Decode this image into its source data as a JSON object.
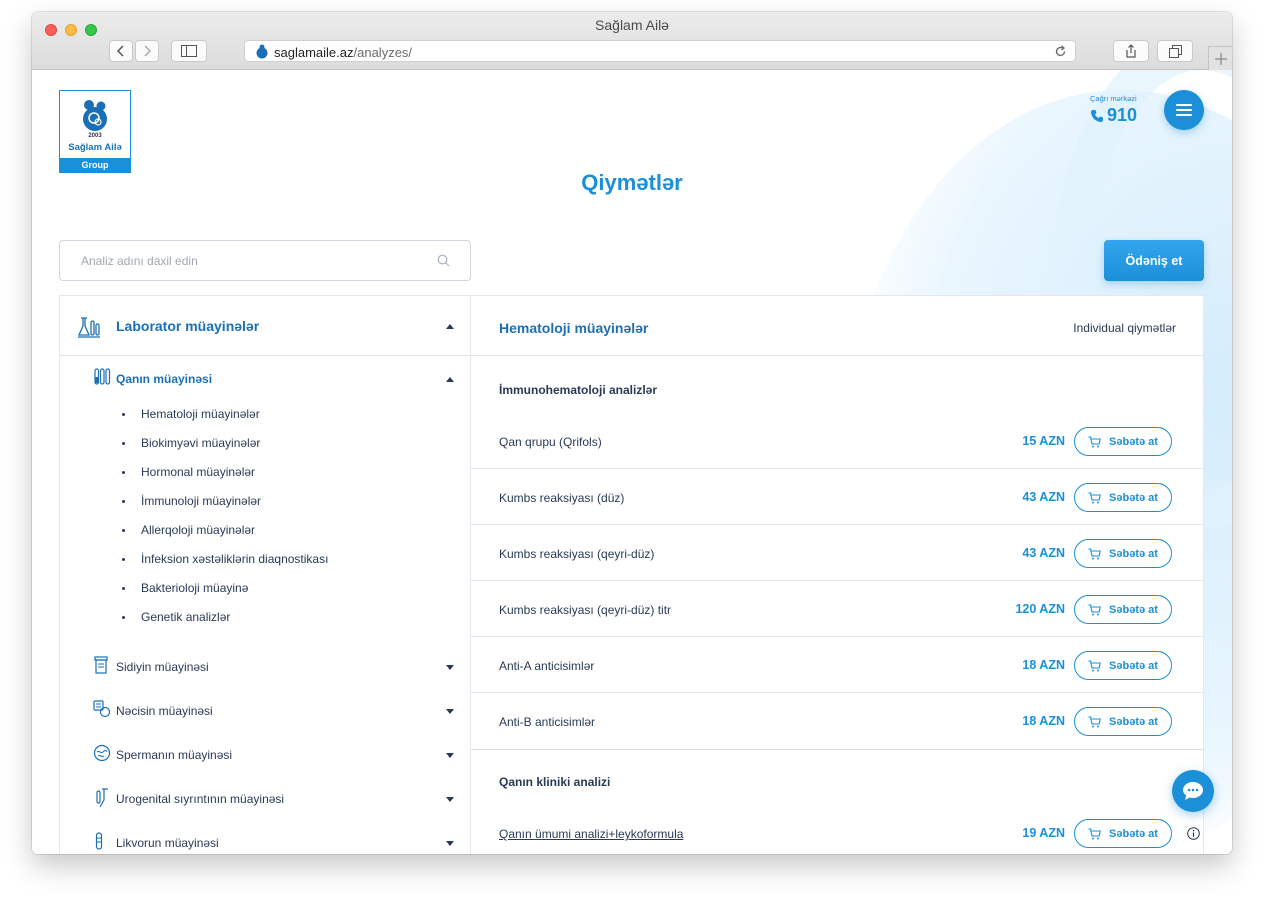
{
  "browser": {
    "window_title": "Sağlam Ailə",
    "url_domain": "saglamaile.az",
    "url_path": "/analyzes/"
  },
  "header": {
    "logo": {
      "year": "2003",
      "name": "Sağlam Ailə",
      "group": "Group"
    },
    "call_center_label": "Çağrı mərkəzi",
    "call_center_number": "910"
  },
  "page_title": "Qiymətlər",
  "search": {
    "placeholder": "Analiz adını daxil edin"
  },
  "pay_button": "Ödəniş et",
  "sidebar": {
    "section_title": "Laborator müayinələr",
    "categories": [
      {
        "label": "Qanın müayinəsi",
        "icon": "test-tubes-icon",
        "subitems": [
          "Hematoloji müayinələr",
          "Biokimyəvi müayinələr",
          "Hormonal müayinələr",
          "İmmunoloji müayinələr",
          "Allerqoloji müayinələr",
          "İnfeksion xəstəliklərin diaqnostikası",
          "Bakterioloji müayinə",
          "Genetik analizlər"
        ]
      },
      {
        "label": "Sidiyin müayinəsi",
        "icon": "urine-container-icon"
      },
      {
        "label": "Nəcisin müayinəsi",
        "icon": "stool-sample-icon"
      },
      {
        "label": "Spermanın müayinəsi",
        "icon": "sperm-icon"
      },
      {
        "label": "Urogenital sıyrıntının müayinəsi",
        "icon": "swab-icon"
      },
      {
        "label": "Likvorun müayinəsi",
        "icon": "vial-icon"
      }
    ]
  },
  "content": {
    "title": "Hematoloji müayinələr",
    "individual_prices": "Individual qiymətlər",
    "cart_label": "Səbətə at",
    "sections": [
      {
        "title": "İmmunohematoloji analizlər",
        "items": [
          {
            "name": "Qan qrupu (Qrifols)",
            "price": "15 AZN"
          },
          {
            "name": "Kumbs reaksiyası (düz)",
            "price": "43 AZN"
          },
          {
            "name": "Kumbs reaksiyası (qeyri-düz)",
            "price": "43 AZN"
          },
          {
            "name": "Kumbs reaksiyası (qeyri-düz) titr",
            "price": "120 AZN"
          },
          {
            "name": "Anti-A anticisimlər",
            "price": "18 AZN"
          },
          {
            "name": "Anti-B anticisimlər",
            "price": "18 AZN"
          }
        ]
      },
      {
        "title": "Qanın kliniki analizi",
        "items": [
          {
            "name": "Qanın ümumi analizi+leykoformula",
            "price": "19 AZN"
          }
        ]
      }
    ]
  },
  "colors": {
    "accent": "#1b8fd8",
    "text": "#2a3a55",
    "border": "#e3e8ee"
  }
}
